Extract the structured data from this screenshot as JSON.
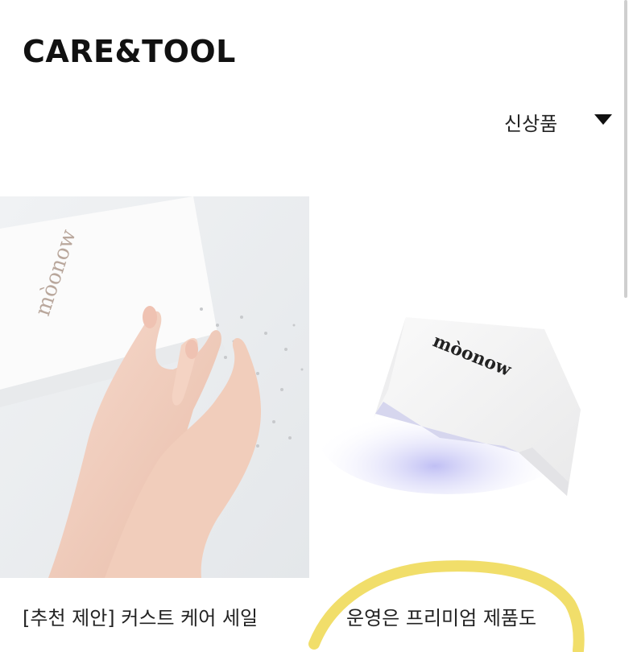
{
  "header": {
    "title": "CARE&TOOL"
  },
  "sort": {
    "selected": "신상품",
    "icon": "triangle-down-icon"
  },
  "products": [
    {
      "title": "[추천 제안] 커스트 케어 세일",
      "image_brand": "mòonow",
      "image_desc": "hands-manicure"
    },
    {
      "title": "운영은 프리미엄 제품도",
      "image_brand": "mòonow",
      "image_desc": "uv-nail-lamp"
    }
  ],
  "colors": {
    "highlight": "#f1de6a",
    "lamp_glow": "#b9b8f3"
  }
}
